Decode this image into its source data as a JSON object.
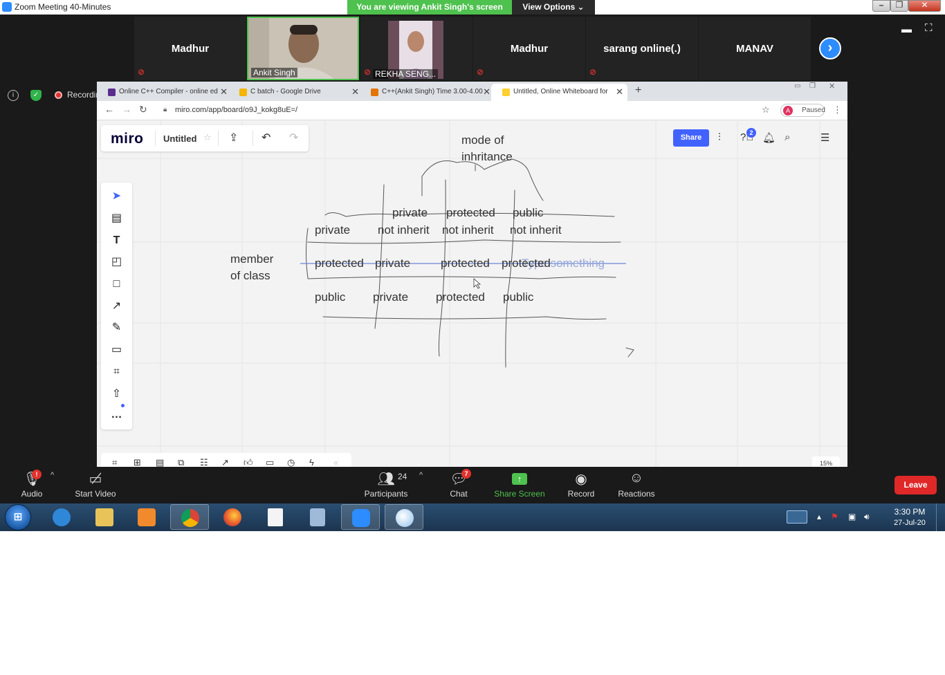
{
  "zoom_window": {
    "title": "Zoom Meeting 40-Minutes",
    "viewing_banner": "You are viewing Ankit Singh's screen",
    "view_options": "View Options ⌄"
  },
  "participants_strip": [
    {
      "name": "Madhur",
      "muted": true
    },
    {
      "name": "Ankit Singh",
      "video": true,
      "muted": false
    },
    {
      "name": "REKHA SENG...",
      "video": true,
      "muted": true
    },
    {
      "name": "Madhur",
      "muted": true
    },
    {
      "name": "sarang online(.)",
      "muted": true
    },
    {
      "name": "MANAV",
      "muted": false
    }
  ],
  "status": {
    "recording_label": "Recording"
  },
  "browser": {
    "tabs": [
      {
        "title": "Online C++ Compiler - online ed",
        "icon_color": "#5b2d8e",
        "active": false
      },
      {
        "title": "C batch - Google Drive",
        "icon_color": "#f4b400",
        "active": false
      },
      {
        "title": "C++(Ankit Singh) Time 3.00-4.00",
        "icon_color": "#e37400",
        "active": false
      },
      {
        "title": "Untitled, Online Whiteboard for",
        "icon_color": "#ffd02f",
        "active": true
      }
    ],
    "url": "miro.com/app/board/o9J_kokg8uE=/",
    "profile_initial": "A",
    "profile_status": "Paused"
  },
  "miro": {
    "logo": "miro",
    "board_title": "Untitled",
    "share_label": "Share",
    "help_badge": "2",
    "zoom_level": "15%",
    "board_texts": {
      "heading_line1": "mode of",
      "heading_line2": "inhritance",
      "side_line1": "member",
      "side_line2": "of class",
      "col_private": "private",
      "col_protected": "protected",
      "col_public": "public",
      "row_private": "private",
      "row_protected": "protected",
      "row_public": "public",
      "cell_1_1": "not inherit",
      "cell_1_2": "not inherit",
      "cell_1_3": "not inherit",
      "cell_2_1": "private",
      "cell_2_2": "protected",
      "cell_2_3": "protected",
      "cell_2_ghost": "Type something",
      "cell_3_1": "private",
      "cell_3_2": "protected",
      "cell_3_3": "public"
    }
  },
  "zoom_controls": {
    "audio": "Audio",
    "start_video": "Start Video",
    "participants": "Participants",
    "participants_count": "24",
    "chat": "Chat",
    "chat_badge": "7",
    "share_screen": "Share Screen",
    "record": "Record",
    "reactions": "Reactions",
    "leave": "Leave"
  },
  "taskbar": {
    "time": "3:30 PM",
    "date": "27-Jul-20"
  }
}
